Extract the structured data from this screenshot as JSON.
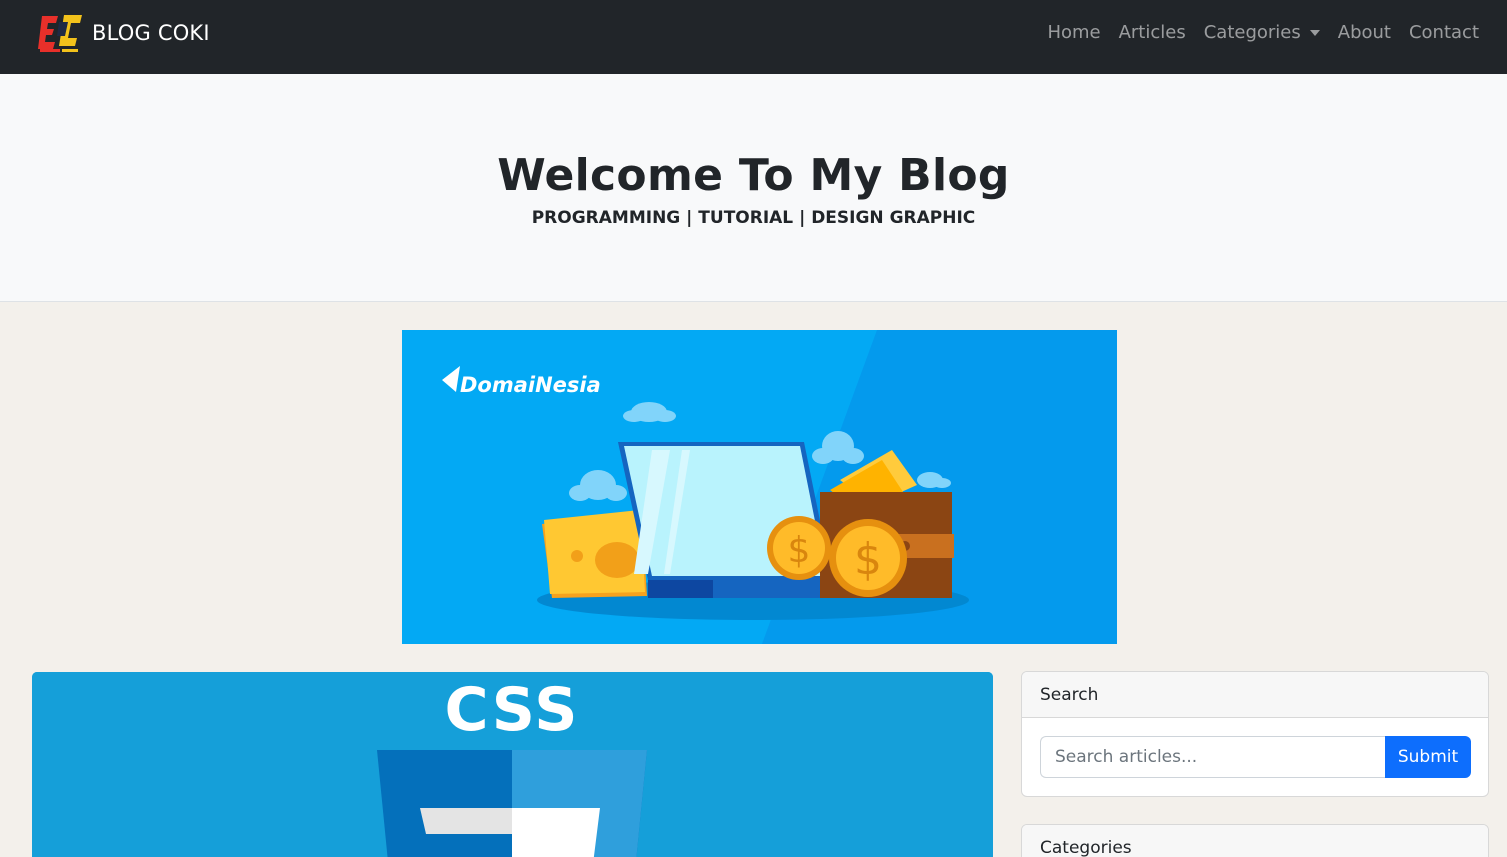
{
  "navbar": {
    "brand": "BLOG COKI",
    "links": [
      {
        "label": "Home"
      },
      {
        "label": "Articles"
      },
      {
        "label": "Categories"
      },
      {
        "label": "About"
      },
      {
        "label": "Contact"
      }
    ]
  },
  "hero": {
    "title": "Welcome To My Blog",
    "subtitle": "PROGRAMMING | TUTORIAL | DESIGN GRAPHIC"
  },
  "banner": {
    "brand": "DomaiNesia",
    "currency_symbol": "$"
  },
  "featured": {
    "logo_text": "CSS"
  },
  "sidebar": {
    "search": {
      "title": "Search",
      "placeholder": "Search articles...",
      "button": "Submit"
    },
    "categories": {
      "title": "Categories"
    }
  },
  "colors": {
    "navbar": "#212529",
    "hero": "#f8f9fa",
    "page_bg": "#f3f0eb",
    "banner_blue": "#03a9f4",
    "css_blue": "#159fd9",
    "primary": "#0d6efd"
  }
}
